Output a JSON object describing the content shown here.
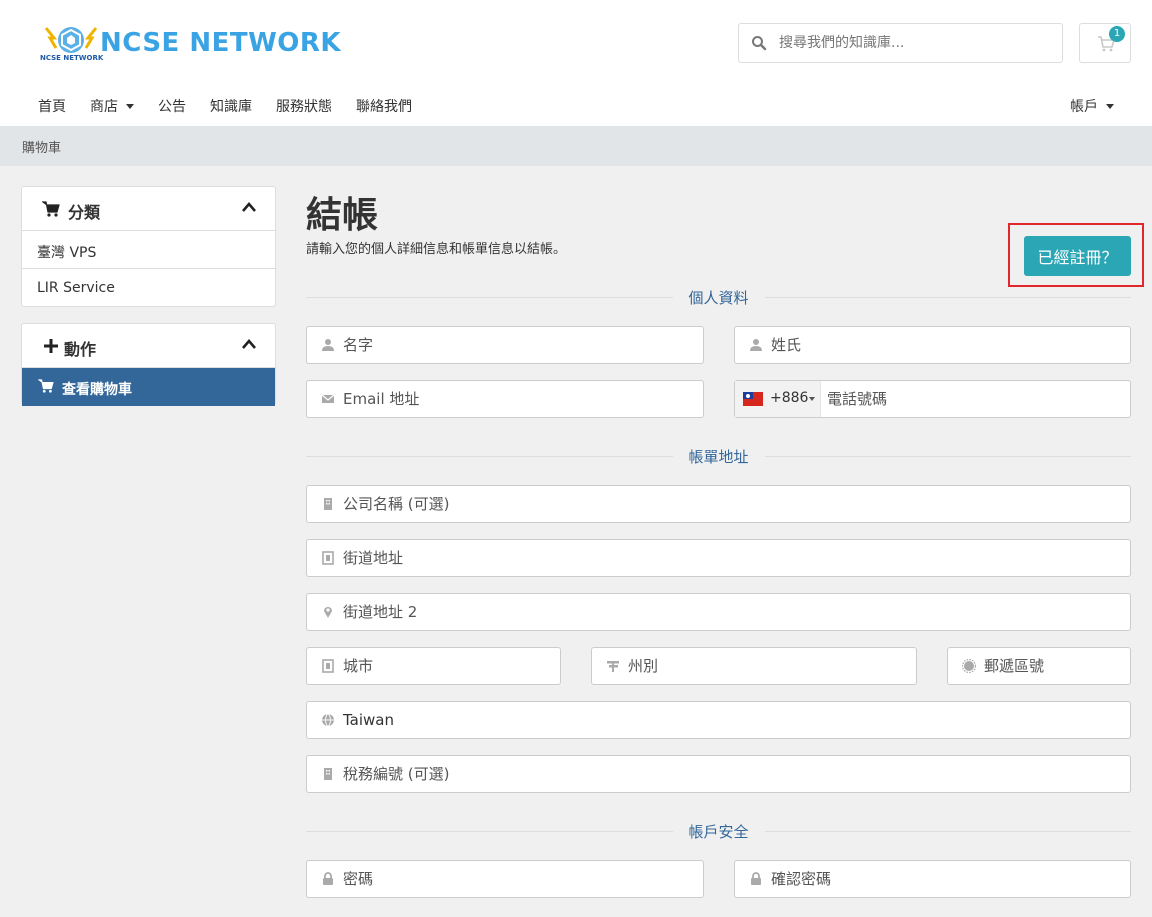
{
  "brand": {
    "name": "NCSE NETWORK",
    "tagline": "NCSE NETWORK"
  },
  "search": {
    "placeholder": "搜尋我們的知識庫..."
  },
  "cart": {
    "count": "1"
  },
  "nav": {
    "items": [
      "首頁",
      "商店",
      "公告",
      "知識庫",
      "服務狀態",
      "聯絡我們"
    ],
    "account": "帳戶"
  },
  "breadcrumb": "購物車",
  "sidebar": {
    "categories": {
      "title": "分類",
      "items": [
        "臺灣 VPS",
        "LIR Service"
      ]
    },
    "actions": {
      "title": "動作",
      "items": [
        "查看購物車"
      ]
    }
  },
  "page": {
    "title": "結帳",
    "subtitle": "請輸入您的個人詳細信息和帳單信息以結帳。",
    "already_registered": "已經註冊？"
  },
  "sections": {
    "personal": "個人資料",
    "billing": "帳單地址",
    "security": "帳戶安全"
  },
  "form": {
    "first_name": "名字",
    "last_name": "姓氏",
    "email": "Email 地址",
    "phone_code": "+886",
    "phone": "電話號碼",
    "company": "公司名稱 (可選)",
    "address1": "街道地址",
    "address2": "街道地址 2",
    "city": "城市",
    "state": "州別",
    "postcode": "郵遞區號",
    "country": "Taiwan",
    "tax_id": "稅務編號 (可選)",
    "password": "密碼",
    "password_confirm": "確認密碼"
  },
  "colors": {
    "accent": "#2ba6b5",
    "sidebar_active": "#336699",
    "section_label": "#336699",
    "highlight_outline": "#e0282a",
    "logo": "#3aa3e3"
  }
}
